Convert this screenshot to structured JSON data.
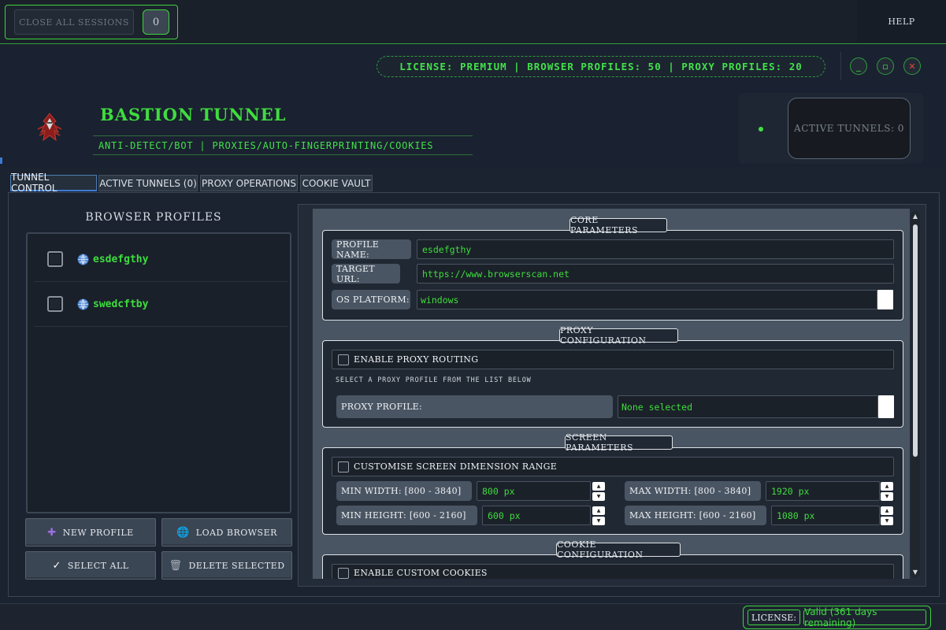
{
  "topbar": {
    "close_sessions_label": "CLOSE ALL SESSIONS",
    "session_count": "0",
    "help_label": "HELP"
  },
  "header": {
    "license_info": "LICENSE: PREMIUM | BROWSER PROFILES: 50 | PROXY PROFILES: 20",
    "minimize_icon": "_",
    "maximize_icon": "▫",
    "close_icon": "✕",
    "app_title": "BASTION TUNNEL",
    "app_subtitle": "ANTI-DETECT/BOT | PROXIES/AUTO-FINGERPRINTING/COOKIES",
    "active_tunnels": "ACTIVE TUNNELS: 0"
  },
  "tabs": [
    {
      "label": "TUNNEL CONTROL",
      "active": true
    },
    {
      "label": "ACTIVE TUNNELS (0)",
      "active": false
    },
    {
      "label": "PROXY OPERATIONS",
      "active": false
    },
    {
      "label": "COOKIE VAULT",
      "active": false
    }
  ],
  "browser_profiles": {
    "title": "BROWSER PROFILES",
    "items": [
      {
        "name": "esdefgthy",
        "checked": false,
        "icon": "globe-icon"
      },
      {
        "name": "swedcftby",
        "checked": false,
        "icon": "globe-icon"
      }
    ],
    "buttons": {
      "new_profile": "NEW PROFILE",
      "load_browser": "LOAD BROWSER",
      "select_all": "SELECT ALL",
      "delete_selected": "DELETE SELECTED"
    },
    "button_icons": {
      "new_profile": "✚",
      "load_browser": "🌐",
      "select_all": "✓",
      "delete_selected": "🗑"
    }
  },
  "core_parameters": {
    "title": "CORE PARAMETERS",
    "profile_name_label": "PROFILE NAME:",
    "profile_name_value": "esdefgthy",
    "target_url_label": "TARGET URL:",
    "target_url_value": "https://www.browserscan.net",
    "os_platform_label": "OS PLATFORM:",
    "os_platform_value": "windows"
  },
  "proxy_configuration": {
    "title": "PROXY CONFIGURATION",
    "enable_label": "ENABLE PROXY ROUTING",
    "hint": "SELECT A PROXY PROFILE FROM THE LIST BELOW",
    "proxy_profile_label": "PROXY PROFILE:",
    "proxy_profile_value": "None selected"
  },
  "screen_parameters": {
    "title": "SCREEN PARAMETERS",
    "customise_label": "CUSTOMISE SCREEN DIMENSION RANGE",
    "min_width_label": "MIN WIDTH: [800 - 3840]",
    "min_width_value": "800 px",
    "max_width_label": "MAX WIDTH: [800 - 3840]",
    "max_width_value": "1920 px",
    "min_height_label": "MIN HEIGHT: [600 - 2160]",
    "min_height_value": "600 px",
    "max_height_label": "MAX HEIGHT: [600 - 2160]",
    "max_height_value": "1080 px"
  },
  "cookie_configuration": {
    "title": "COOKIE CONFIGURATION",
    "enable_label": "ENABLE CUSTOM COOKIES"
  },
  "statusbar": {
    "license_label": "LICENSE:",
    "license_value": "Valid (361 days remaining)"
  },
  "colors": {
    "accent_green": "#3fdc3f",
    "background": "#1b2230",
    "close_red": "#e2473f"
  }
}
